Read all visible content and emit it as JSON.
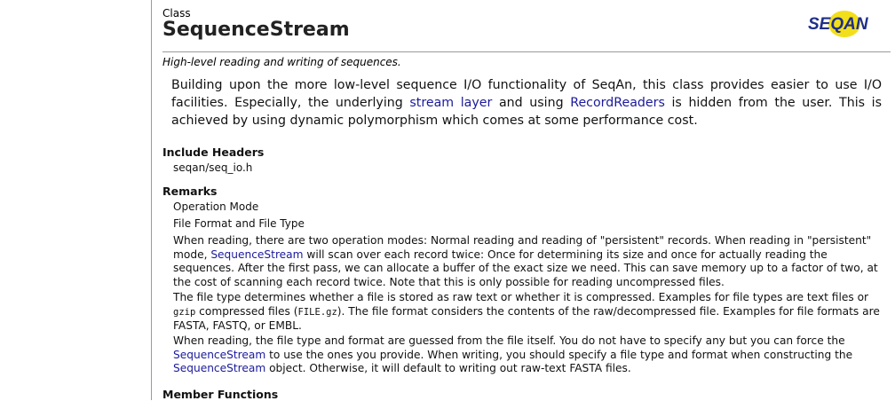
{
  "header": {
    "kind": "Class",
    "title": "SequenceStream",
    "logo_text": "SEQAN",
    "logo_colors": {
      "primary": "#1f2f8a",
      "accent": "#f2df1b"
    }
  },
  "summary": "High-level reading and writing of sequences.",
  "description": {
    "part1": "Building upon the more low-level sequence I/O functionality of SeqAn, this class provides easier to use I/O facilities. Especially, the underlying ",
    "link1": "stream layer",
    "part2": " and using ",
    "link2": "RecordReaders",
    "part3": " is hidden from the user. This is achieved by using dynamic polymorphism which comes at some performance cost."
  },
  "include_headers": {
    "heading": "Include Headers",
    "value": "seqan/seq_io.h"
  },
  "remarks": {
    "heading": "Remarks",
    "item1": "Operation Mode",
    "item2": "File Format and File Type",
    "p1a": "When reading, there are two operation modes: Normal reading and reading of \"persistent\" records. When reading in \"persistent\" mode, ",
    "p1link": "SequenceStream",
    "p1b": " will scan over each record twice: Once for determining its size and once for actually reading the sequences. After the first pass, we can allocate a buffer of the exact size we need. This can save memory up to a factor of two, at the cost of scanning each record twice. Note that this is only possible for reading uncompressed files.",
    "p2a": "The file type determines whether a file is stored as raw text or whether it is compressed. Examples for file types are text files or ",
    "p2code1": "gzip",
    "p2b": " compressed files (",
    "p2code2": "FILE.gz",
    "p2c": "). The file format considers the contents of the raw/decompressed file. Examples for file formats are FASTA, FASTQ, or EMBL.",
    "p3a": "When reading, the file type and format are guessed from the file itself. You do not have to specify any but you can force the ",
    "p3link1": "SequenceStream",
    "p3b": " to use the ones you provide. When writing, you should specify a file type and format when constructing the ",
    "p3link2": "SequenceStream",
    "p3c": " object. Otherwise, it will default to writing out raw-text FASTA files."
  },
  "member_functions": {
    "heading": "Member Functions"
  }
}
